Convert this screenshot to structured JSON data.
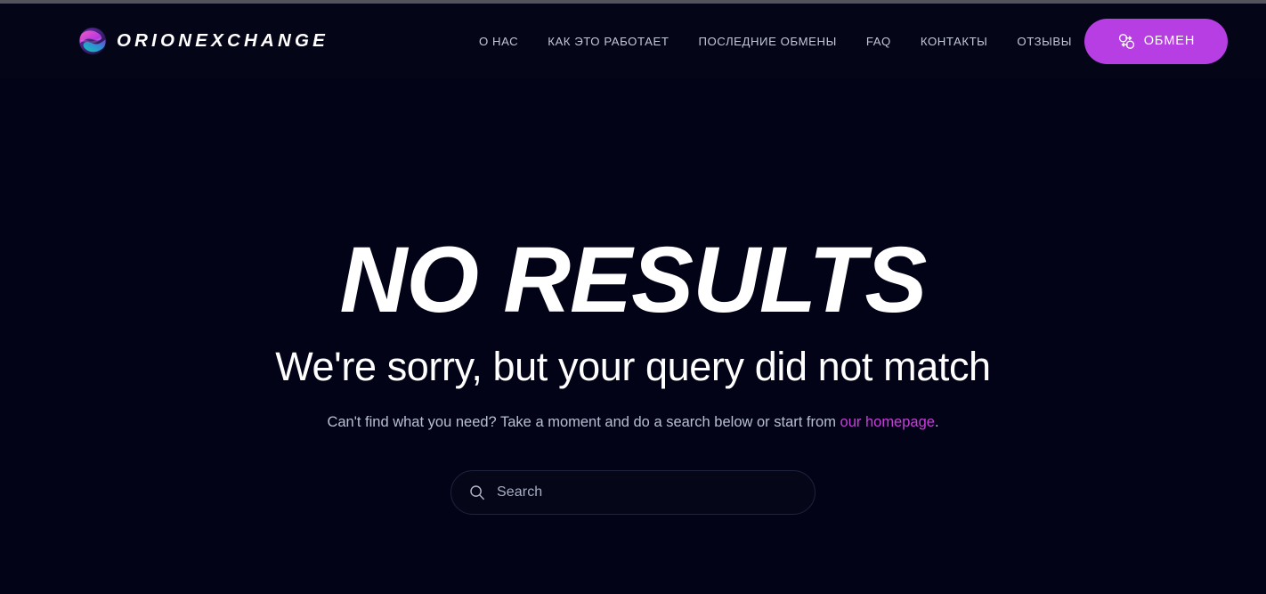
{
  "browser": {
    "chrome_strip_color": "#53535b"
  },
  "theme": {
    "background": "#030318",
    "accent": "#b63ee2",
    "link": "#c83fda",
    "text_primary": "#ffffff",
    "text_muted": "#b9bfd2",
    "nav_text": "#c3c7d6",
    "input_border": "#20233c"
  },
  "header": {
    "brand": {
      "name": "ORIONEXCHANGE",
      "logo_icon": "globe-swirl-icon"
    },
    "nav": [
      {
        "label": "О НАС",
        "name": "nav-item-about"
      },
      {
        "label": "КАК ЭТО РАБОТАЕТ",
        "name": "nav-item-how-it-works"
      },
      {
        "label": "ПОСЛЕДНИЕ ОБМЕНЫ",
        "name": "nav-item-recent-exchanges"
      },
      {
        "label": "FAQ",
        "name": "nav-item-faq"
      },
      {
        "label": "КОНТАКТЫ",
        "name": "nav-item-contacts"
      },
      {
        "label": "ОТЗЫВЫ",
        "name": "nav-item-reviews"
      }
    ],
    "cta": {
      "label": "ОБМЕН",
      "icon": "exchange-arrows-icon"
    }
  },
  "main": {
    "headline": "NO RESULTS",
    "subheadline": "We're sorry, but your query did not match",
    "lede": {
      "before": "Can't find what you need? Take a moment and do a search below or start from ",
      "link_text": "our homepage",
      "after": "."
    },
    "search": {
      "placeholder": "Search",
      "value": "",
      "icon": "search-icon"
    }
  }
}
